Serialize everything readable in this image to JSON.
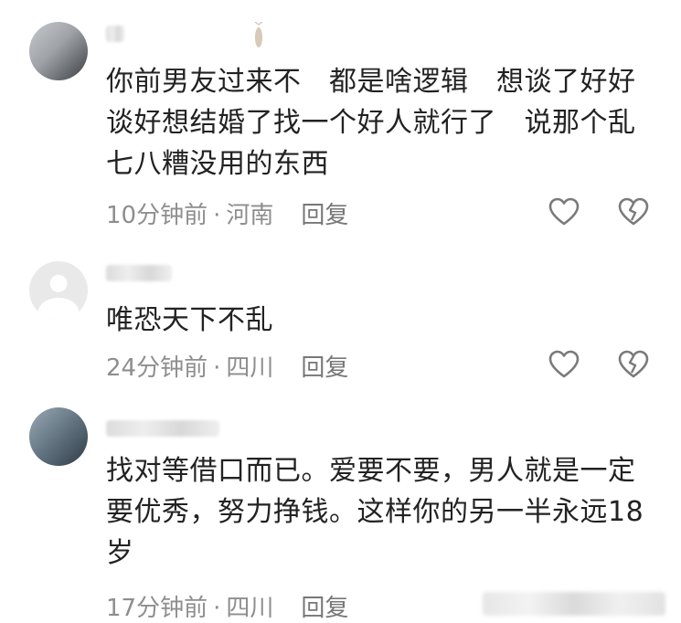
{
  "comments": [
    {
      "text": "你前男友过来不　都是啥逻辑　想谈了好好 谈好想结婚了找一个好人就行了　说那个乱七八糟没用的东西",
      "time": "10分钟前",
      "location": "河南",
      "reply": "回复"
    },
    {
      "text": "唯恐天下不乱",
      "time": "24分钟前",
      "location": "四川",
      "reply": "回复"
    },
    {
      "text": "找对等借口而已。爱要不要，男人就是一定要优秀，努力挣钱。这样你的另一半永远18岁",
      "time": "17分钟前",
      "location": "四川",
      "reply": "回复"
    }
  ],
  "meta_separator": "·",
  "icons": {
    "like": "heart-outline-icon",
    "dislike": "broken-heart-icon"
  },
  "colors": {
    "text": "#222222",
    "meta": "#8e8e8e",
    "icon": "#7a7a7a"
  }
}
